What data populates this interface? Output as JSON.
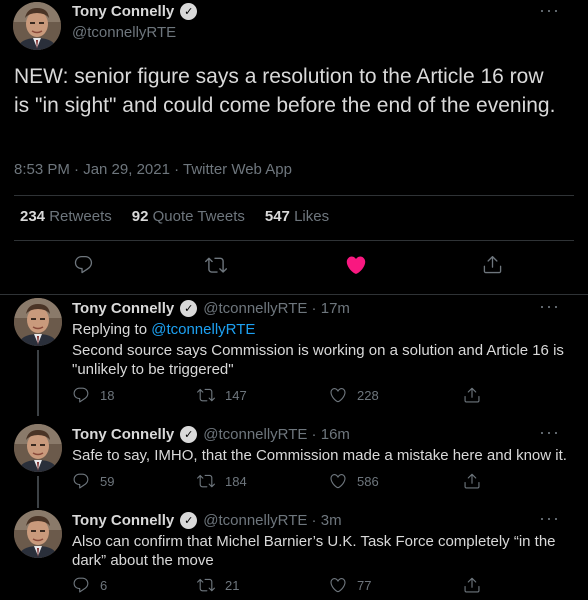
{
  "main_tweet": {
    "author_name": "Tony Connelly",
    "handle": "@tconnellyRTE",
    "text": "NEW: senior figure says a resolution to the Article 16 row is \"in sight\" and could come before the end of the evening.",
    "meta": "8:53 PM · Jan 29, 2021 · Twitter Web App",
    "stats": [
      {
        "count": "234",
        "label": "Retweets"
      },
      {
        "count": "92",
        "label": "Quote Tweets"
      },
      {
        "count": "547",
        "label": "Likes"
      }
    ],
    "more": "···"
  },
  "replies": [
    {
      "author_name": "Tony Connelly",
      "handle_time": "@tconnellyRTE · 17m",
      "replying_prefix": "Replying to",
      "replying_to": "@tconnellyRTE",
      "text": "Second source says Commission is working on a solution and Article 16 is \"unlikely to be triggered\"",
      "replies_count": "18",
      "retweets_count": "147",
      "likes_count": "228"
    },
    {
      "author_name": "Tony Connelly",
      "handle_time": "@tconnellyRTE · 16m",
      "text": "Safe to say, IMHO, that the Commission made a mistake here and know it.",
      "replies_count": "59",
      "retweets_count": "184",
      "likes_count": "586"
    },
    {
      "author_name": "Tony Connelly",
      "handle_time": "@tconnellyRTE · 3m",
      "text": "Also can confirm that Michel Barnier’s U.K. Task Force completely “in the dark” about the move",
      "replies_count": "6",
      "retweets_count": "21",
      "likes_count": "77"
    }
  ],
  "icons": {
    "verified": "verified-badge",
    "reply": "reply-icon",
    "retweet": "retweet-icon",
    "like": "heart-icon",
    "share": "share-icon"
  },
  "colors": {
    "background": "#000000",
    "text": "#d9d9d9",
    "muted": "#6e767d",
    "link": "#1da1f2",
    "like_active": "#f91880"
  }
}
